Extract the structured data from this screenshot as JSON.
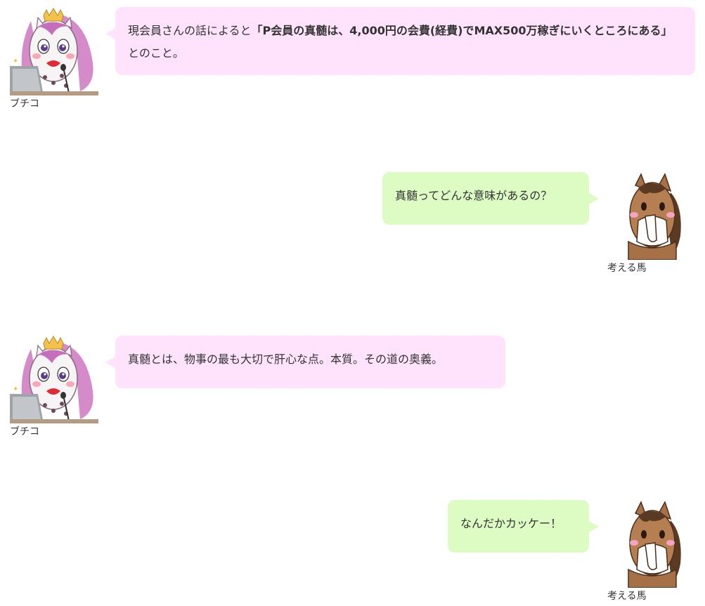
{
  "messages": [
    {
      "speaker": "ブチコ",
      "side": "left",
      "avatar_icon": "unicorn-icon",
      "text_before": "現会員さんの話によると",
      "text_bold": "「P会員の真髄は、4,000円の会費(経費)でMAX500万稼ぎにいくところにある」",
      "text_after": "とのこと。"
    },
    {
      "speaker": "考える馬",
      "side": "right",
      "avatar_icon": "horse-icon",
      "text": "真髄ってどんな意味があるの？"
    },
    {
      "speaker": "ブチコ",
      "side": "left",
      "avatar_icon": "unicorn-icon",
      "text": "真髄とは、物事の最も大切で肝心な点。本質。その道の奥義。"
    },
    {
      "speaker": "考える馬",
      "side": "right",
      "avatar_icon": "horse-icon",
      "text": "なんだかカッケー！"
    }
  ],
  "colors": {
    "left_bubble": "#ffe2fb",
    "right_bubble": "#ddfcc4",
    "text": "#333333"
  }
}
